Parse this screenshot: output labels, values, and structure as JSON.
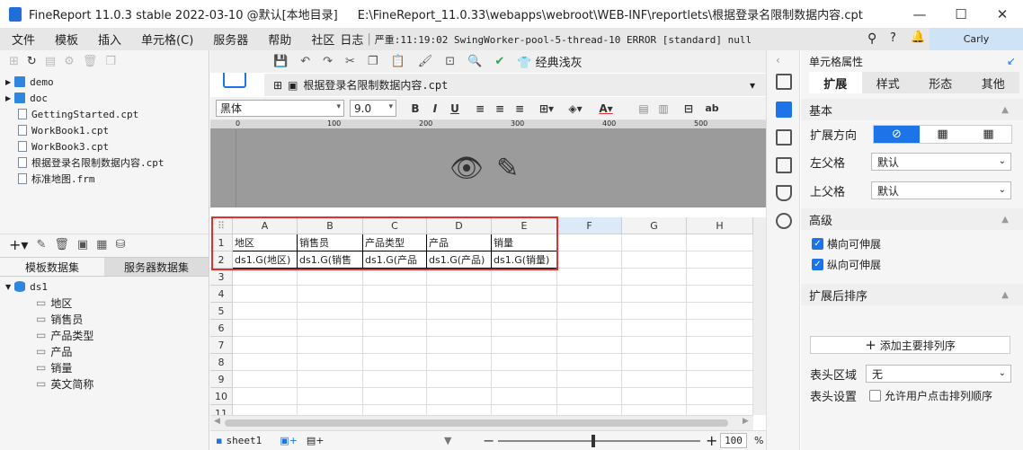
{
  "window": {
    "title": "FineReport 11.0.3 stable 2022-03-10 @默认[本地目录]",
    "path": "E:\\FineReport_11.0.33\\webapps\\webroot\\WEB-INF\\reportlets\\根据登录名限制数据内容.cpt",
    "minimize": "—",
    "maximize": "☐",
    "close": "✕"
  },
  "menu": {
    "items": [
      "文件",
      "模板",
      "插入",
      "单元格(C)",
      "服务器",
      "帮助",
      "社区"
    ],
    "log_label": "日志",
    "log_text": "严重:11:19:02 SwingWorker-pool-5-thread-10 ERROR [standard] null",
    "user": "Carly"
  },
  "left": {
    "files": [
      {
        "name": "demo",
        "type": "folder"
      },
      {
        "name": "doc",
        "type": "folder"
      },
      {
        "name": "GettingStarted.cpt",
        "type": "file"
      },
      {
        "name": "WorkBook1.cpt",
        "type": "file"
      },
      {
        "name": "WorkBook3.cpt",
        "type": "file"
      },
      {
        "name": "根据登录名限制数据内容.cpt",
        "type": "file"
      },
      {
        "name": "标准地图.frm",
        "type": "file"
      }
    ],
    "tabs": [
      "模板数据集",
      "服务器数据集"
    ],
    "dataset": {
      "name": "ds1",
      "fields": [
        "地区",
        "销售员",
        "产品类型",
        "产品",
        "销量",
        "英文简称"
      ]
    }
  },
  "editor": {
    "classic_gray": "经典浅灰",
    "doc_tab": "根据登录名限制数据内容.cpt",
    "font": "黑体",
    "size": "9.0",
    "ruler_ticks": [
      "0",
      "100",
      "200",
      "300",
      "400",
      "500"
    ],
    "columns": [
      "A",
      "B",
      "C",
      "D",
      "E",
      "F",
      "G",
      "H"
    ],
    "rows": [
      "1",
      "2",
      "3",
      "4",
      "5",
      "6",
      "7",
      "8",
      "9",
      "10",
      "11"
    ],
    "headers": [
      "地区",
      "销售员",
      "产品类型",
      "产品",
      "销量"
    ],
    "bindings": [
      "ds1.G(地区)",
      "ds1.G(销售",
      "ds1.G(产品",
      "ds1.G(产品)",
      "ds1.G(销量)"
    ],
    "sheet": "sheet1",
    "zoom": "100",
    "zoom_unit": "%"
  },
  "panel": {
    "title": "单元格属性",
    "tabs": [
      "扩展",
      "样式",
      "形态",
      "其他"
    ],
    "basic": "基本",
    "expand_dir": "扩展方向",
    "left_parent": "左父格",
    "left_parent_value": "默认",
    "top_parent": "上父格",
    "top_parent_value": "默认",
    "advanced": "高级",
    "h_expand": "横向可伸展",
    "v_expand": "纵向可伸展",
    "sort": "扩展后排序",
    "add_sort": "添加主要排列序",
    "header_area": "表头区域",
    "header_area_value": "无",
    "header_setting": "表头设置",
    "allow_sort": "允许用户点击排列顺序"
  },
  "colors": {
    "accent": "#1d73e8",
    "highlight": "#e03030"
  }
}
